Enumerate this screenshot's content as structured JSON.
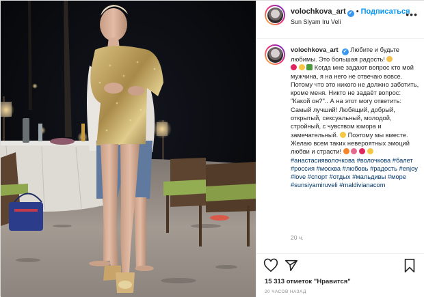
{
  "header": {
    "username": "volochkova_art",
    "verified_icon": "✔",
    "separator": "•",
    "follow_label": "Подписаться",
    "location": "Sun Siyam Iru Veli",
    "more_label": "•••"
  },
  "caption": {
    "username": "volochkova_art",
    "verified_icon": "✔",
    "text_1": "Любите и будьте любимы. Это большая радость!",
    "text_2": "Когда мне задают вопрос кто мой мужчина, я на него не отвечаю вовсе. Потому что это никого не должно заботить, кроме меня. Никто не задаёт вопрос: \"Какой он?\".. А на этот могу ответить: Самый лучший! Любящий, добрый, открытый, сексуальный, молодой, стройный, с чувством юмора и замечательный.",
    "text_3": "Поэтому мы вместе. Желаю всем таких невероятных эмоций любви и страсти!",
    "hashtags": "#анастасияволочкова #волочкова #балет #россия #москва #любовь #радость #enjoy #love #спорт #отдых #мальдивы #море #sunsiyamiruveli #maldivianacom",
    "time": "20 ч."
  },
  "actions": {
    "like_icon": "heart-icon",
    "share_icon": "paper-plane-icon",
    "save_icon": "bookmark-icon"
  },
  "likes_text": "15 313 отметок \"Нравится\"",
  "posted_ago": "20 ЧАСОВ НАЗАД",
  "colors": {
    "accent": "#0095f6",
    "verified": "#3897f0",
    "hashtag": "#00376b",
    "muted": "#8e8e8e"
  }
}
